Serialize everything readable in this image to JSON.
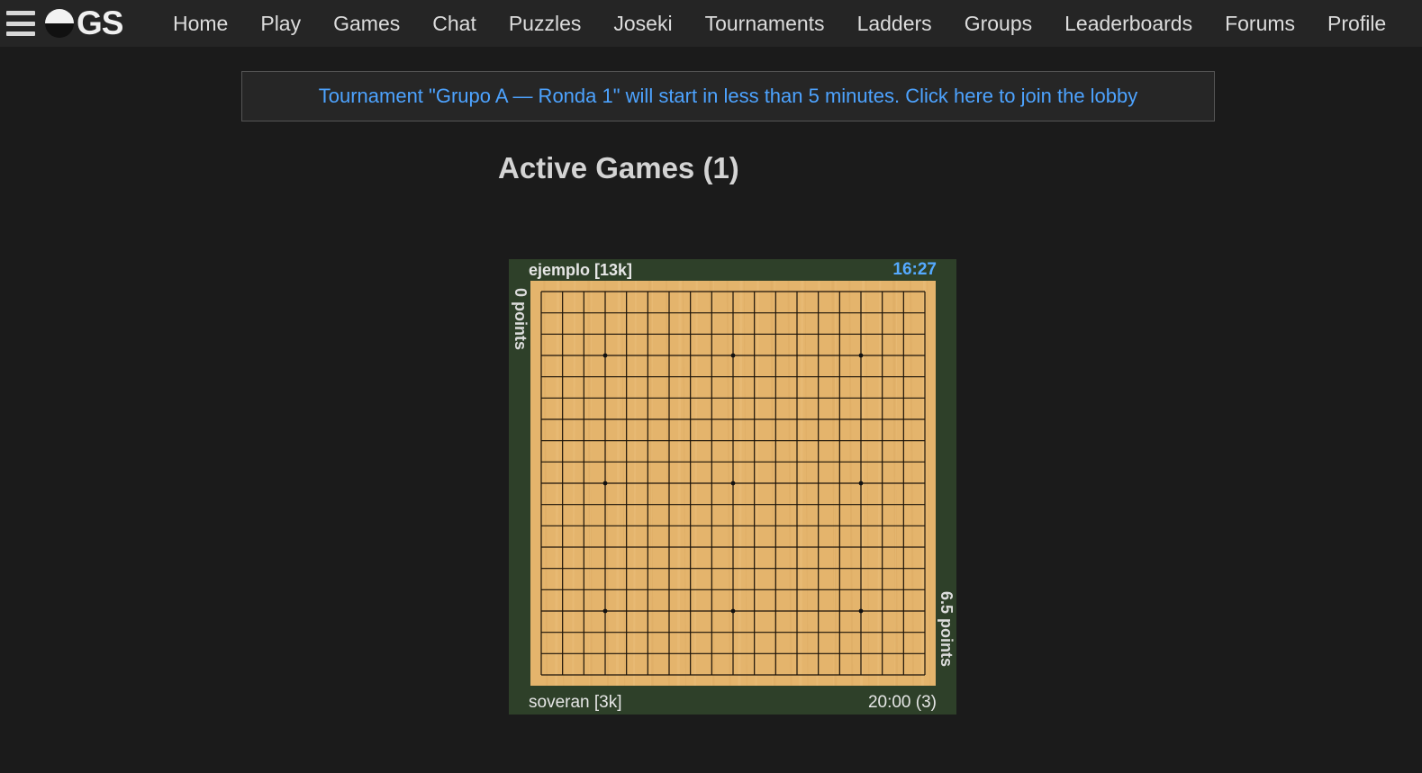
{
  "nav": {
    "menu_icon": "hamburger-menu-icon",
    "logo_text": "GS",
    "logo_icon": "half-go-stone-icon",
    "links": [
      "Home",
      "Play",
      "Games",
      "Chat",
      "Puzzles",
      "Joseki",
      "Tournaments",
      "Ladders",
      "Groups",
      "Leaderboards",
      "Forums",
      "Profile"
    ]
  },
  "banner": {
    "text": "Tournament \"Grupo A — Ronda 1\" will start in less than 5 minutes. Click here to join the lobby"
  },
  "active_games": {
    "title": "Active Games (1)"
  },
  "game": {
    "top_player": "ejemplo  [13k]",
    "top_clock": "16:27",
    "bottom_player": "soveran  [3k]",
    "bottom_clock": "20:00  (3)",
    "left_score": "0 points",
    "right_score": "6.5 points",
    "board_size": 19,
    "colors": {
      "card_bg": "#2e4029",
      "board_wood": "#e4b46c",
      "active_clock": "#55aaff"
    }
  }
}
